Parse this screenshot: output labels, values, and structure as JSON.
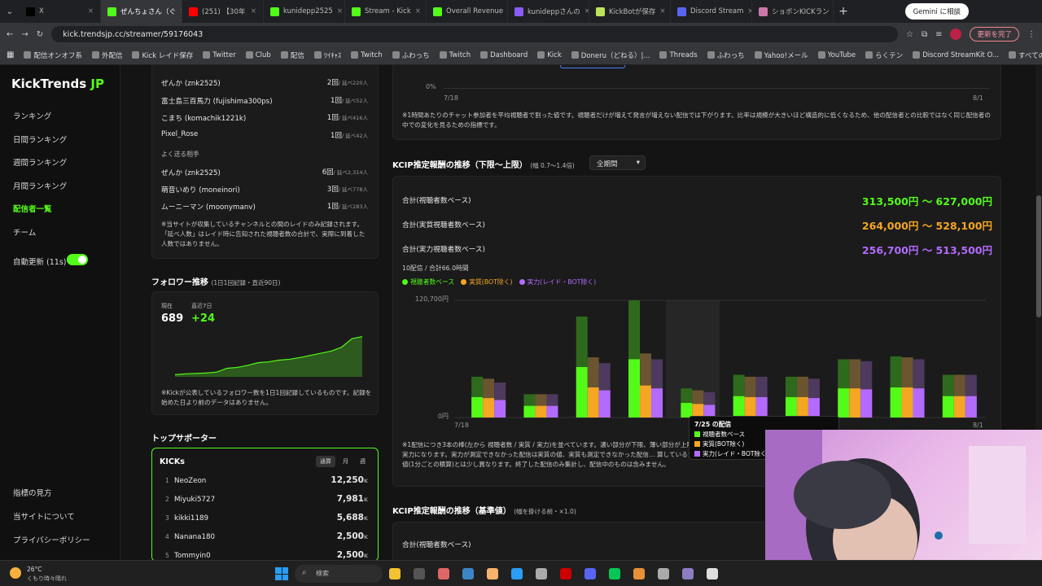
{
  "browser": {
    "tabs": [
      {
        "label": "X",
        "color": "#000"
      },
      {
        "label": "ぜんちょさん（ぐ",
        "color": "#53fc18",
        "active": true
      },
      {
        "label": "(251) 【30年",
        "color": "#f00"
      },
      {
        "label": "kunidepp2525",
        "color": "#53fc18"
      },
      {
        "label": "Stream - Kick",
        "color": "#53fc18"
      },
      {
        "label": "Overall Revenue",
        "color": "#53fc18"
      },
      {
        "label": "kunideppさんの",
        "color": "#8a5cf6"
      },
      {
        "label": "KickBotが保存",
        "color": "#b9e35a"
      },
      {
        "label": "Discord Stream",
        "color": "#5865f2"
      },
      {
        "label": "ショボンKICKラン",
        "color": "#c7a"
      }
    ],
    "gemini": "Gemini に相談",
    "url": "kick.trendsjp.cc/streamer/59176043",
    "update_btn": "更新を完了",
    "bookmarks": [
      "配信オンオフ系",
      "外配信",
      "Kick レイド保存",
      "Twitter",
      "Club",
      "配信",
      "ﾂｲｷｬｽ",
      "Twitch",
      "ふわっち",
      "Twitch",
      "Dashboard",
      "Kick",
      "Doneru（どねる）|...",
      "Threads",
      "ふわっち",
      "Yahoo!メール",
      "YouTube",
      "らくテン",
      "Discord StreamKit O...",
      "すべてのブックマーク"
    ]
  },
  "sidebar": {
    "logo_main": "KickTrends",
    "logo_suffix": " JP",
    "nav": [
      "ランキング",
      "日間ランキング",
      "週間ランキング",
      "月間ランキング",
      "配信者一覧",
      "チーム"
    ],
    "auto_update": "自動更新 (11s)",
    "footer": [
      "指標の見方",
      "当サイトについて",
      "プライバシーポリシー"
    ]
  },
  "raid": {
    "top_rows": [
      {
        "name": "ぜんか (znk2525)",
        "count": "2回",
        "sub": "/ 延べ220人"
      },
      {
        "name": "富士島三百馬力 (fujishima300ps)",
        "count": "1回",
        "sub": "/ 延べ52人"
      },
      {
        "name": "こまち (komachik1221k)",
        "count": "1回",
        "sub": "/ 延べ416人"
      },
      {
        "name": "Pixel_Rose",
        "count": "1回",
        "sub": "/ 延べ42人"
      }
    ],
    "send_title": "よく送る相手",
    "send_rows": [
      {
        "name": "ぜんか (znk2525)",
        "count": "6回",
        "sub": "/ 延べ2,314人"
      },
      {
        "name": "萌音いめり (moneinori)",
        "count": "3回",
        "sub": "/ 延べ778人"
      },
      {
        "name": "ムーニーマン (moonymanv)",
        "count": "1回",
        "sub": "/ 延べ283人"
      }
    ],
    "note": "※当サイトが収集しているチャンネルとの間のレイドのみ記録されます。「延べ人数」はレイド時に告知された視聴者数の合計で、実際に到着した人数ではありません。"
  },
  "followers": {
    "title": "フォロワー推移",
    "sub": "(1日1回記録・直近90日)",
    "now_label": "現在",
    "now": "689",
    "week_label": "直近7日",
    "week": "+24",
    "values": [
      600,
      602,
      603,
      604,
      606,
      615,
      617,
      622,
      628,
      630,
      634,
      636,
      640,
      645,
      650,
      655,
      664,
      684,
      689
    ],
    "note": "※Kickが公表しているフォロワー数を1日1回記録しているものです。記録を始めた日より前のデータはありません。"
  },
  "supporters": {
    "title": "トップサポーター",
    "kicks": "KICKs",
    "tabs": [
      "通算",
      "月",
      "週"
    ],
    "rows": [
      {
        "rank": "1",
        "name": "NeoZeon",
        "val": "12,250"
      },
      {
        "rank": "2",
        "name": "Miyuki5727",
        "val": "7,981"
      },
      {
        "rank": "3",
        "name": "kikki1189",
        "val": "5,688"
      },
      {
        "rank": "4",
        "name": "Nanana180",
        "val": "2,500"
      },
      {
        "rank": "5",
        "name": "Tommyin0",
        "val": "2,500"
      }
    ],
    "unit": "K"
  },
  "top_chart": {
    "zero": "0%",
    "x_start": "7/18",
    "x_end": "8/1",
    "note": "※1時間あたりのチャット参加者を平均視聴者で割った値です。視聴者だけが増えて発言が増えない配信では下がります。比率は規模が大きいほど構造的に低くなるため、他の配信者との比較ではなく同じ配信者の中での変化を見るための指標です。"
  },
  "kcip": {
    "title": "KCIP推定報酬の推移（下限〜上限）",
    "sub": "(幅 0.7〜1.4倍)",
    "period": "全期間",
    "totals": [
      {
        "label": "合計(視聴者数ベース)",
        "value": "313,500円 〜 627,000円",
        "color": "#53fc18"
      },
      {
        "label": "合計(実質視聴者数ベース)",
        "value": "264,000円 〜 528,100円",
        "color": "#f5a623"
      },
      {
        "label": "合計(実力視聴者数ベース)",
        "value": "256,700円 〜 513,500円",
        "color": "#b36bff"
      }
    ],
    "summary": "10配信 / 合計66.0時間",
    "legend": [
      {
        "name": "視聴者数ベース",
        "color": "#53fc18"
      },
      {
        "name": "実質(BOT除く)",
        "color": "#f5a623"
      },
      {
        "name": "実力(レイド・BOT除く)",
        "color": "#b36bff"
      }
    ],
    "tooltip": {
      "title": "7/25 の配信",
      "rows": [
        "視聴者数ベース",
        "実質(BOT除く)",
        "実力(レイド・BOT除く)"
      ]
    },
    "note": "※1配信につき3本の棒(左から 視聴者数 / 実質 / 実力)を並べています。濃い部分が下限、薄い部分が上限までの幅です。実質 と 実力になります。実力が測定できなかった配信は実質の値、実質も測定できなかった配信… 算しているため、配信詳細ページの値(1分ごとの積算)とは少し異なります。終了した配信のみ集計し、配信中のものは含みません。"
  },
  "chart_data": {
    "type": "bar",
    "ylabel_top": "120,700円",
    "ylabel_zero": "0円",
    "x_start": "7/18",
    "x_end": "8/1",
    "ylim": [
      0,
      120700
    ],
    "series": [
      {
        "name": "視聴者数ベース",
        "color": "#53fc18",
        "low": [
          21000,
          12000,
          52000,
          60000,
          15000,
          22000,
          21000,
          30000,
          31000,
          22000
        ],
        "high": [
          42000,
          24000,
          104000,
          120700,
          30000,
          44000,
          42000,
          60000,
          63000,
          44000
        ]
      },
      {
        "name": "実質(BOT除く)",
        "color": "#f5a623",
        "low": [
          20000,
          12000,
          31000,
          33000,
          14000,
          21000,
          21000,
          30000,
          31000,
          22000
        ],
        "high": [
          40000,
          24000,
          62000,
          66000,
          28000,
          42000,
          42000,
          60000,
          62000,
          44000
        ]
      },
      {
        "name": "実力(レイド・BOT除く)",
        "color": "#b36bff",
        "low": [
          18000,
          12000,
          28000,
          30000,
          13000,
          21000,
          20000,
          29000,
          30000,
          22000
        ],
        "high": [
          36000,
          24000,
          56000,
          60000,
          26000,
          42000,
          40000,
          58000,
          60000,
          44000
        ]
      }
    ]
  },
  "kcip2": {
    "title": "KCIP推定報酬の推移（基準値）",
    "sub": "(幅を掛ける前・×1.0)",
    "row1": "合計(視聴者数ベース)"
  },
  "taskbar": {
    "temp": "26°C",
    "weather": "くもり時々晴れ",
    "search": "検索"
  }
}
